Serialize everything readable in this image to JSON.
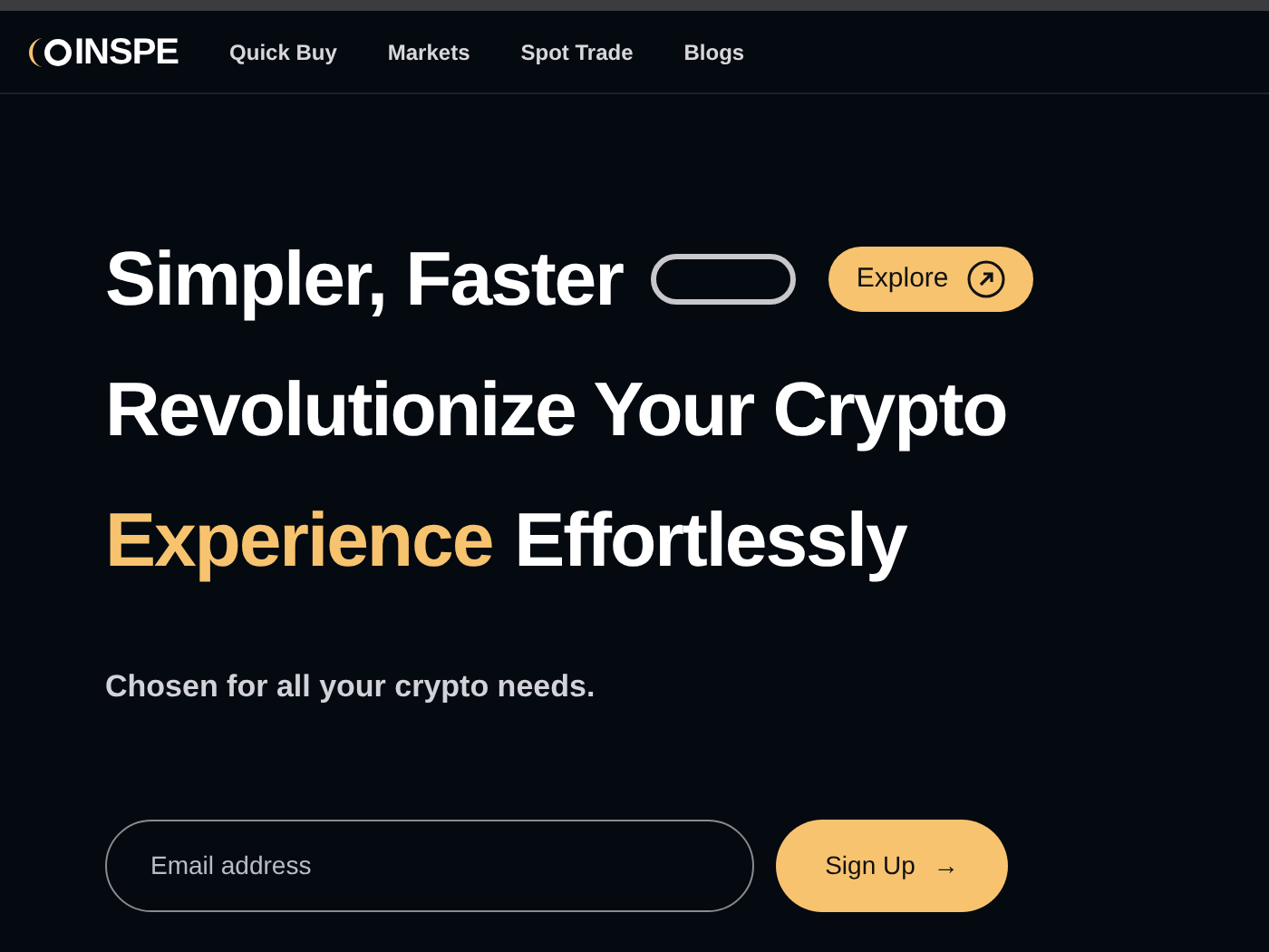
{
  "nav": {
    "logo": "INSPE",
    "links": [
      "Quick Buy",
      "Markets",
      "Spot Trade",
      "Blogs"
    ]
  },
  "hero": {
    "line1": "Simpler, Faster",
    "explore": "Explore",
    "line2": "Revolutionize Your Crypto",
    "line3_accent": "Experience",
    "line3_rest": "Effortlessly",
    "subtitle": "Chosen for all your crypto needs."
  },
  "signup": {
    "placeholder": "Email address",
    "button": "Sign Up",
    "button_arrow": "→"
  }
}
